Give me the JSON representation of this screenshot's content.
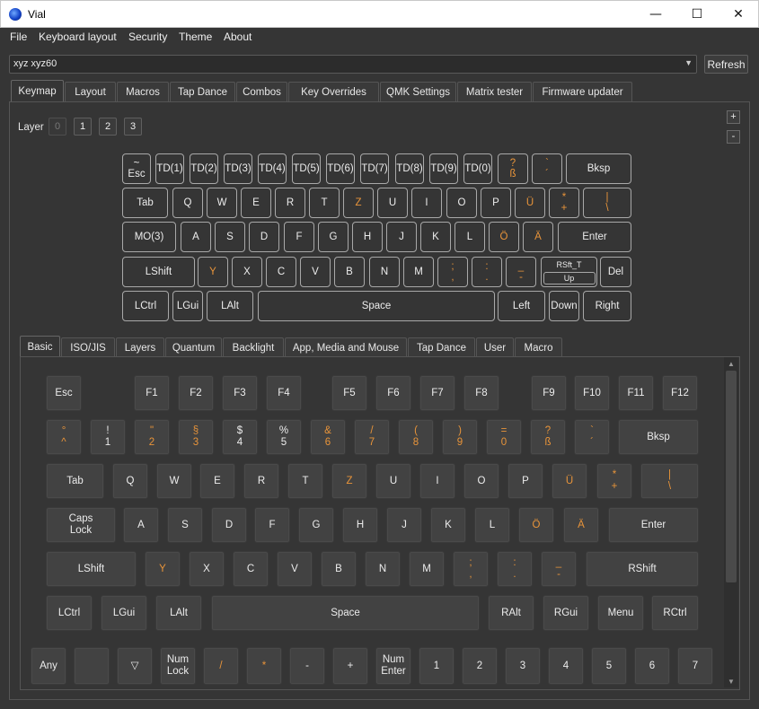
{
  "window": {
    "title": "Vial",
    "minimize": "—",
    "maximize": "☐",
    "close": "✕"
  },
  "menubar": [
    "File",
    "Keyboard layout",
    "Security",
    "Theme",
    "About"
  ],
  "device": {
    "selected": "xyz xyz60",
    "refresh_label": "Refresh"
  },
  "main_tabs": [
    "Keymap",
    "Layout",
    "Macros",
    "Tap Dance",
    "Combos",
    "Key Overrides",
    "QMK Settings",
    "Matrix tester",
    "Firmware updater"
  ],
  "layers": {
    "label": "Layer",
    "items": [
      "0",
      "1",
      "2",
      "3"
    ],
    "plus": "+",
    "minus": "-"
  },
  "keymap_rows": [
    [
      [
        "~",
        "Esc"
      ],
      [
        "TD(1)"
      ],
      [
        "TD(2)"
      ],
      [
        "TD(3)"
      ],
      [
        "TD(4)"
      ],
      [
        "TD(5)"
      ],
      [
        "TD(6)"
      ],
      [
        "TD(7)"
      ],
      [
        "TD(8)"
      ],
      [
        "TD(9)"
      ],
      [
        "TD(0)"
      ],
      [
        "?",
        "ß"
      ],
      [
        "`",
        "´"
      ],
      [
        "Bksp"
      ]
    ],
    [
      [
        "Tab"
      ],
      [
        "Q"
      ],
      [
        "W"
      ],
      [
        "E"
      ],
      [
        "R"
      ],
      [
        "T"
      ],
      [
        "Z"
      ],
      [
        "U"
      ],
      [
        "I"
      ],
      [
        "O"
      ],
      [
        "P"
      ],
      [
        "Ü"
      ],
      [
        "*",
        "+"
      ],
      [
        "|",
        "\\"
      ]
    ],
    [
      [
        "MO(3)"
      ],
      [
        "A"
      ],
      [
        "S"
      ],
      [
        "D"
      ],
      [
        "F"
      ],
      [
        "G"
      ],
      [
        "H"
      ],
      [
        "J"
      ],
      [
        "K"
      ],
      [
        "L"
      ],
      [
        "Ö"
      ],
      [
        "Ä"
      ],
      [
        "Enter"
      ]
    ],
    [
      [
        "LShift"
      ],
      [
        "Y"
      ],
      [
        "X"
      ],
      [
        "C"
      ],
      [
        "V"
      ],
      [
        "B"
      ],
      [
        "N"
      ],
      [
        "M"
      ],
      [
        ";",
        ","
      ],
      [
        ":",
        "."
      ],
      [
        "_",
        "-"
      ],
      [
        "RSft_T",
        "Up"
      ],
      [
        "Del"
      ]
    ],
    [
      [
        "LCtrl"
      ],
      [
        "LGui"
      ],
      [
        "LAlt"
      ],
      [
        "Space"
      ],
      [
        "Left"
      ],
      [
        "Down"
      ],
      [
        "Right"
      ]
    ]
  ],
  "keycode_tabs": [
    "Basic",
    "ISO/JIS",
    "Layers",
    "Quantum",
    "Backlight",
    "App, Media and Mouse",
    "Tap Dance",
    "User",
    "Macro"
  ],
  "basic_rows": [
    [
      [
        "Esc"
      ],
      [
        "F1"
      ],
      [
        "F2"
      ],
      [
        "F3"
      ],
      [
        "F4"
      ],
      [
        "F5"
      ],
      [
        "F6"
      ],
      [
        "F7"
      ],
      [
        "F8"
      ],
      [
        "F9"
      ],
      [
        "F10"
      ],
      [
        "F11"
      ],
      [
        "F12"
      ]
    ],
    [
      [
        "°",
        "^"
      ],
      [
        "!",
        "1"
      ],
      [
        "\"",
        "2"
      ],
      [
        "§",
        "3"
      ],
      [
        "$",
        "4"
      ],
      [
        "%",
        "5"
      ],
      [
        "&",
        "6"
      ],
      [
        "/",
        "7"
      ],
      [
        "(",
        "8"
      ],
      [
        ")",
        "9"
      ],
      [
        "=",
        "0"
      ],
      [
        "?",
        "ß"
      ],
      [
        "`",
        "´"
      ],
      [
        "Bksp"
      ]
    ],
    [
      [
        "Tab"
      ],
      [
        "Q"
      ],
      [
        "W"
      ],
      [
        "E"
      ],
      [
        "R"
      ],
      [
        "T"
      ],
      [
        "Z"
      ],
      [
        "U"
      ],
      [
        "I"
      ],
      [
        "O"
      ],
      [
        "P"
      ],
      [
        "Ü"
      ],
      [
        "*",
        "+"
      ],
      [
        "|",
        "\\"
      ]
    ],
    [
      [
        "Caps",
        "Lock"
      ],
      [
        "A"
      ],
      [
        "S"
      ],
      [
        "D"
      ],
      [
        "F"
      ],
      [
        "G"
      ],
      [
        "H"
      ],
      [
        "J"
      ],
      [
        "K"
      ],
      [
        "L"
      ],
      [
        "Ö"
      ],
      [
        "Ä"
      ],
      [
        "Enter"
      ]
    ],
    [
      [
        "LShift"
      ],
      [
        "Y"
      ],
      [
        "X"
      ],
      [
        "C"
      ],
      [
        "V"
      ],
      [
        "B"
      ],
      [
        "N"
      ],
      [
        "M"
      ],
      [
        ";",
        ","
      ],
      [
        ":",
        "."
      ],
      [
        "_",
        "-"
      ],
      [
        "RShift"
      ]
    ],
    [
      [
        "LCtrl"
      ],
      [
        "LGui"
      ],
      [
        "LAlt"
      ],
      [
        "Space"
      ],
      [
        "RAlt"
      ],
      [
        "RGui"
      ],
      [
        "Menu"
      ],
      [
        "RCtrl"
      ]
    ],
    [
      [
        "Any"
      ],
      [
        ""
      ],
      [
        "▽"
      ],
      [
        "Num",
        "Lock"
      ],
      [
        "/"
      ],
      [
        "*"
      ],
      [
        "-"
      ],
      [
        "+"
      ],
      [
        "Num",
        "Enter"
      ],
      [
        "1"
      ],
      [
        "2"
      ],
      [
        "3"
      ],
      [
        "4"
      ],
      [
        "5"
      ],
      [
        "6"
      ],
      [
        "7"
      ]
    ]
  ],
  "accent_color": "#e8943a"
}
